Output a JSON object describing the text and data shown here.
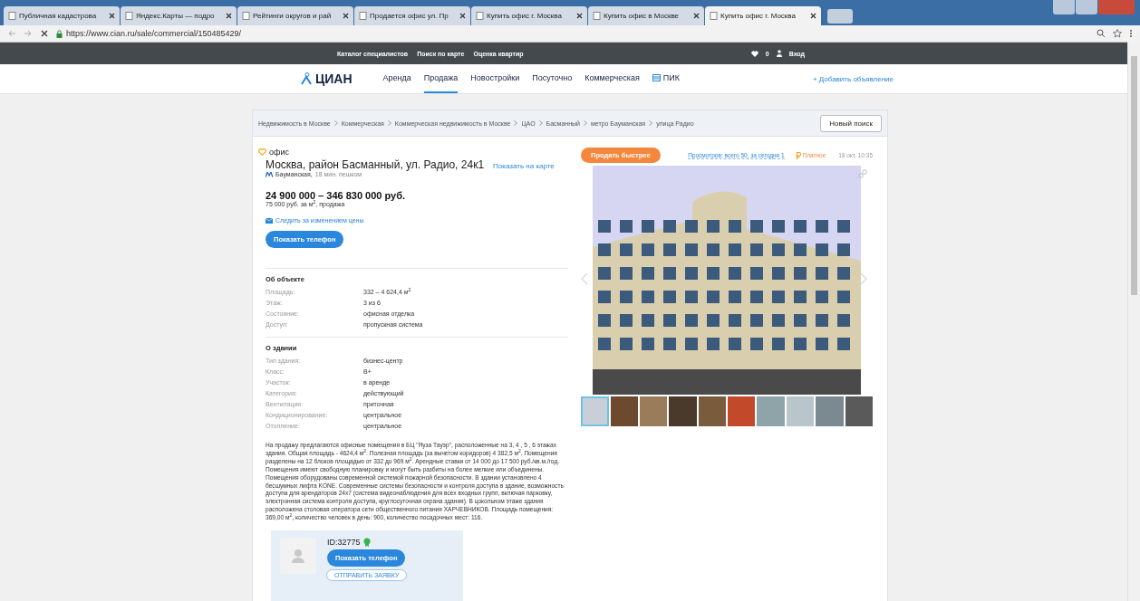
{
  "browser": {
    "tabs": [
      {
        "title": "Публичная кадастрова",
        "selected": false
      },
      {
        "title": "Яндекс.Карты — подро",
        "selected": false
      },
      {
        "title": "Рейтинги округов и рай",
        "selected": false
      },
      {
        "title": "Продается офис ул. Пр",
        "selected": false
      },
      {
        "title": "Купить офис г. Москва",
        "selected": false
      },
      {
        "title": "Купить офис в Москве",
        "selected": false
      },
      {
        "title": "Купить офис г. Москва",
        "selected": true
      }
    ],
    "url": "https://www.cian.ru/sale/commercial/150485429/"
  },
  "topbar": {
    "links": [
      "Каталог специалистов",
      "Поиск по карте",
      "Оценка квартир"
    ],
    "favorites_count": "0",
    "login": "Вход"
  },
  "header": {
    "logo": "ЦИАН",
    "nav": [
      {
        "label": "Аренда",
        "selected": false
      },
      {
        "label": "Продажа",
        "selected": true
      },
      {
        "label": "Новостройки",
        "selected": false
      },
      {
        "label": "Посуточно",
        "selected": false
      },
      {
        "label": "Коммерческая",
        "selected": false
      },
      {
        "label": "ПИК",
        "selected": false
      }
    ],
    "add_listing": "+ Добавить объявление"
  },
  "breadcrumbs": [
    "Недвижимость в Москве",
    "Коммерческая",
    "Коммерческая недвижимость в Москве",
    "ЦАО",
    "Басманный",
    "метро Бауманская",
    "улица Радио"
  ],
  "new_search": "Новый поиск",
  "listing": {
    "type": "офис",
    "address": "Москва, район Басманный, ул. Радио, 24к1",
    "map_link": "Показать на карте",
    "metro": {
      "station": "Бауманская,",
      "walk": "18 мин. пешком"
    },
    "price": "24 900 000 – 346 830 000 руб.",
    "price_note": "75 000 руб. за м$^{2}$, продажа",
    "follow_price": "Следить за изменением цены",
    "phone_button": "Показать телефон"
  },
  "object_section": {
    "title": "Об объекте",
    "rows": [
      {
        "label": "Площадь:",
        "value": "332 – 4 624,4 м$^{2}$"
      },
      {
        "label": "Этаж:",
        "value": "3 из 6"
      },
      {
        "label": "Состояние:",
        "value": "офисная отделка"
      },
      {
        "label": "Доступ:",
        "value": "пропускная система"
      }
    ]
  },
  "building_section": {
    "title": "О здании",
    "rows": [
      {
        "label": "Тип здания:",
        "value": "бизнес-центр"
      },
      {
        "label": "Класс:",
        "value": "B+"
      },
      {
        "label": "Участок:",
        "value": "в аренде"
      },
      {
        "label": "Категория:",
        "value": "действующий"
      },
      {
        "label": "Вентиляция:",
        "value": "приточная"
      },
      {
        "label": "Кондиционирование:",
        "value": "центральное"
      },
      {
        "label": "Отопление:",
        "value": "центральное"
      }
    ]
  },
  "description": "На продажу предлагаются офисные помещения в БЦ \"Яуза Тауэр\", расположенные на 3, 4 , 5 , 6 этажах здания. Общая площадь - 4624,4 м$^{2}$. Полезная площадь (за вычетом коридоров) 4 382,5 м$^{2}$. Помещения разделены на 12 блоков площадью от 332 до 969 м$^{2}$. Арендные ставки от 14 000 до 17 500 руб./кв.м./год. Помещения имеют свободную планировку и могут быть разбиты на более мелкие или объединены. Помещения оборудованы современной системой пожарной безопасности. В здании установлено 4 бесшумных лифта KONE. Современные системы безопасности и контроля доступа в здание, возможность доступа для арендаторов 24х7 (система видеонаблюдения для всех входных групп, включая парковку, электронная система контроля доступа, круглосуточная охрана здания). В цокольном этаже здания расположена столовая оператора сети общественного питания ХАРЧЕВНИКОВ. Площадь помещения: 369,00 м$^{2}$, количество человек в день: 900, количество посадочных мест: 116.",
  "agent": {
    "id": "ID:32775",
    "phone_button": "Показать телефон",
    "request_button": "ОТПРАВИТЬ ЗАЯВКУ"
  },
  "gallery": {
    "sell_faster": "Продать быстрее",
    "views": "Просмотров: всего 50, за сегодня 1",
    "paid": "Платное",
    "date": "18 окт, 10:35",
    "thumbnails": [
      {
        "selected": true
      },
      {
        "selected": false
      },
      {
        "selected": false
      },
      {
        "selected": false
      },
      {
        "selected": false
      },
      {
        "selected": false
      },
      {
        "selected": false
      },
      {
        "selected": false
      },
      {
        "selected": false
      },
      {
        "selected": false
      }
    ]
  }
}
